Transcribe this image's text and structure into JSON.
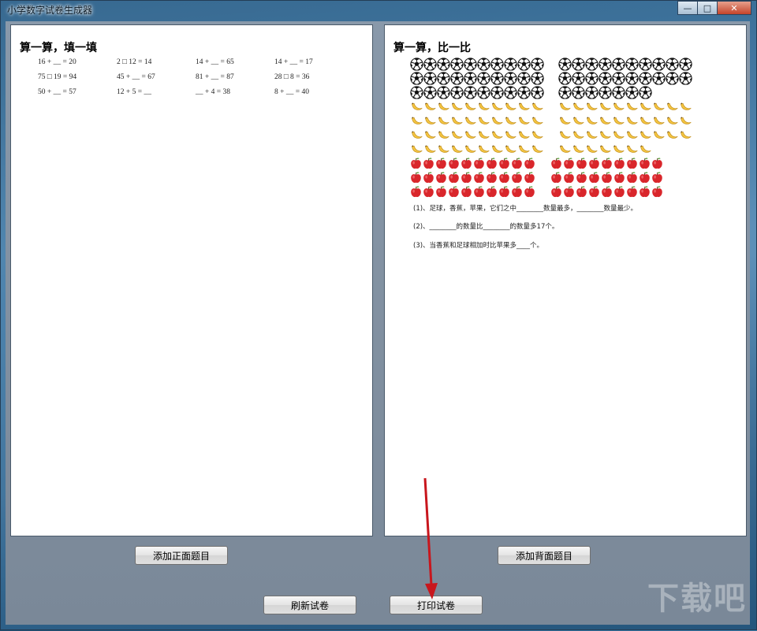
{
  "window": {
    "title": "小学数字试卷生成器",
    "controls": {
      "minimize": "—",
      "maximize": "□",
      "close": "✕"
    }
  },
  "front_page": {
    "title": "算一算，填一填",
    "equations": [
      [
        "16 + __ = 20",
        "2 □ 12 = 14",
        "14 + __ = 65",
        "14 + __ = 17"
      ],
      [
        "75 □ 19 = 94",
        "45 + __ = 67",
        "81 + __ = 87",
        "28 □ 8 = 36"
      ],
      [
        "50 + __ = 57",
        "12 + 5 = __",
        "__ + 4 = 38",
        "8 + __ = 40"
      ]
    ]
  },
  "back_page": {
    "title": "算一算，比一比",
    "pictograph": {
      "soccer_balls": {
        "icon": "soccer-ball-icon",
        "rows": [
          [
            10,
            10
          ],
          [
            10,
            10
          ],
          [
            10,
            7
          ]
        ]
      },
      "bananas": {
        "icon": "banana-icon",
        "rows": [
          [
            10,
            10
          ],
          [
            10,
            10
          ],
          [
            10,
            10
          ],
          [
            10,
            7
          ]
        ]
      },
      "apples": {
        "icon": "apple-icon",
        "rows": [
          [
            10,
            9
          ],
          [
            10,
            9
          ],
          [
            10,
            9
          ]
        ]
      }
    },
    "questions": [
      "(1)、足球，香蕉，苹果，它们之中________数量最多，________数量最少。",
      "(2)、________的数量比________的数量多17个。",
      "(3)、当香蕉和足球相加时比苹果多____个。"
    ]
  },
  "buttons": {
    "add_front": "添加正面题目",
    "add_back": "添加背面题目",
    "refresh": "刷新试卷",
    "print": "打印试卷"
  },
  "watermark": "下载吧"
}
